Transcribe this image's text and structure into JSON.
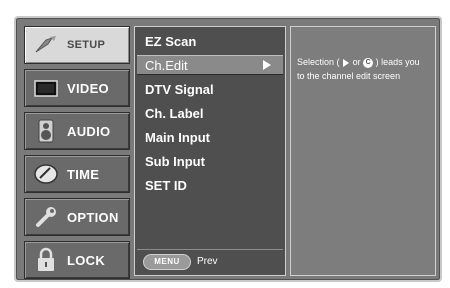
{
  "tabs": [
    {
      "label": "SETUP",
      "icon": "setup-icon",
      "active": true
    },
    {
      "label": "VIDEO",
      "icon": "tv-icon",
      "active": false
    },
    {
      "label": "AUDIO",
      "icon": "speaker-icon",
      "active": false
    },
    {
      "label": "TIME",
      "icon": "clock-icon",
      "active": false
    },
    {
      "label": "OPTION",
      "icon": "wrench-icon",
      "active": false
    },
    {
      "label": "LOCK",
      "icon": "lock-icon",
      "active": false
    }
  ],
  "menu": {
    "items": [
      "EZ Scan",
      "Ch.Edit",
      "DTV Signal",
      "Ch. Label",
      "Main Input",
      "Sub Input",
      "SET ID"
    ],
    "selected_index": 1,
    "menu_button": "MENU",
    "prev_label": "Prev"
  },
  "help": {
    "text_before": "Selection (",
    "or_text": "or",
    "circle_glyph": "C",
    "text_after": ") leads you to the channel edit screen"
  },
  "colors": {
    "frame": "#7a7a7a",
    "menu_bg": "#4f4f4f",
    "highlight": "#8a8a8a",
    "active_tab": "#d9d9d9"
  }
}
